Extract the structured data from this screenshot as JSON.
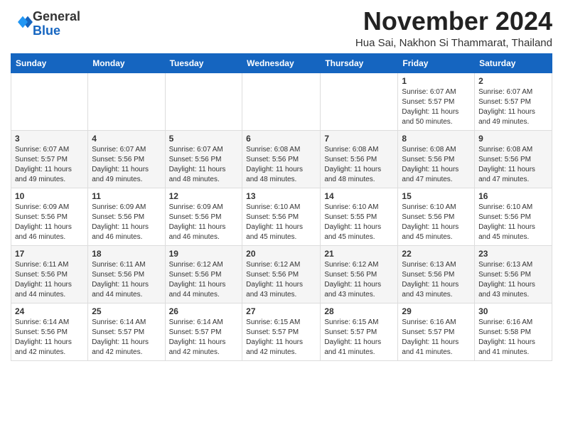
{
  "header": {
    "logo_general": "General",
    "logo_blue": "Blue",
    "month_title": "November 2024",
    "location": "Hua Sai, Nakhon Si Thammarat, Thailand"
  },
  "days_of_week": [
    "Sunday",
    "Monday",
    "Tuesday",
    "Wednesday",
    "Thursday",
    "Friday",
    "Saturday"
  ],
  "weeks": [
    [
      {
        "day": "",
        "info": ""
      },
      {
        "day": "",
        "info": ""
      },
      {
        "day": "",
        "info": ""
      },
      {
        "day": "",
        "info": ""
      },
      {
        "day": "",
        "info": ""
      },
      {
        "day": "1",
        "info": "Sunrise: 6:07 AM\nSunset: 5:57 PM\nDaylight: 11 hours\nand 50 minutes."
      },
      {
        "day": "2",
        "info": "Sunrise: 6:07 AM\nSunset: 5:57 PM\nDaylight: 11 hours\nand 49 minutes."
      }
    ],
    [
      {
        "day": "3",
        "info": "Sunrise: 6:07 AM\nSunset: 5:57 PM\nDaylight: 11 hours\nand 49 minutes."
      },
      {
        "day": "4",
        "info": "Sunrise: 6:07 AM\nSunset: 5:56 PM\nDaylight: 11 hours\nand 49 minutes."
      },
      {
        "day": "5",
        "info": "Sunrise: 6:07 AM\nSunset: 5:56 PM\nDaylight: 11 hours\nand 48 minutes."
      },
      {
        "day": "6",
        "info": "Sunrise: 6:08 AM\nSunset: 5:56 PM\nDaylight: 11 hours\nand 48 minutes."
      },
      {
        "day": "7",
        "info": "Sunrise: 6:08 AM\nSunset: 5:56 PM\nDaylight: 11 hours\nand 48 minutes."
      },
      {
        "day": "8",
        "info": "Sunrise: 6:08 AM\nSunset: 5:56 PM\nDaylight: 11 hours\nand 47 minutes."
      },
      {
        "day": "9",
        "info": "Sunrise: 6:08 AM\nSunset: 5:56 PM\nDaylight: 11 hours\nand 47 minutes."
      }
    ],
    [
      {
        "day": "10",
        "info": "Sunrise: 6:09 AM\nSunset: 5:56 PM\nDaylight: 11 hours\nand 46 minutes."
      },
      {
        "day": "11",
        "info": "Sunrise: 6:09 AM\nSunset: 5:56 PM\nDaylight: 11 hours\nand 46 minutes."
      },
      {
        "day": "12",
        "info": "Sunrise: 6:09 AM\nSunset: 5:56 PM\nDaylight: 11 hours\nand 46 minutes."
      },
      {
        "day": "13",
        "info": "Sunrise: 6:10 AM\nSunset: 5:56 PM\nDaylight: 11 hours\nand 45 minutes."
      },
      {
        "day": "14",
        "info": "Sunrise: 6:10 AM\nSunset: 5:55 PM\nDaylight: 11 hours\nand 45 minutes."
      },
      {
        "day": "15",
        "info": "Sunrise: 6:10 AM\nSunset: 5:56 PM\nDaylight: 11 hours\nand 45 minutes."
      },
      {
        "day": "16",
        "info": "Sunrise: 6:10 AM\nSunset: 5:56 PM\nDaylight: 11 hours\nand 45 minutes."
      }
    ],
    [
      {
        "day": "17",
        "info": "Sunrise: 6:11 AM\nSunset: 5:56 PM\nDaylight: 11 hours\nand 44 minutes."
      },
      {
        "day": "18",
        "info": "Sunrise: 6:11 AM\nSunset: 5:56 PM\nDaylight: 11 hours\nand 44 minutes."
      },
      {
        "day": "19",
        "info": "Sunrise: 6:12 AM\nSunset: 5:56 PM\nDaylight: 11 hours\nand 44 minutes."
      },
      {
        "day": "20",
        "info": "Sunrise: 6:12 AM\nSunset: 5:56 PM\nDaylight: 11 hours\nand 43 minutes."
      },
      {
        "day": "21",
        "info": "Sunrise: 6:12 AM\nSunset: 5:56 PM\nDaylight: 11 hours\nand 43 minutes."
      },
      {
        "day": "22",
        "info": "Sunrise: 6:13 AM\nSunset: 5:56 PM\nDaylight: 11 hours\nand 43 minutes."
      },
      {
        "day": "23",
        "info": "Sunrise: 6:13 AM\nSunset: 5:56 PM\nDaylight: 11 hours\nand 43 minutes."
      }
    ],
    [
      {
        "day": "24",
        "info": "Sunrise: 6:14 AM\nSunset: 5:56 PM\nDaylight: 11 hours\nand 42 minutes."
      },
      {
        "day": "25",
        "info": "Sunrise: 6:14 AM\nSunset: 5:57 PM\nDaylight: 11 hours\nand 42 minutes."
      },
      {
        "day": "26",
        "info": "Sunrise: 6:14 AM\nSunset: 5:57 PM\nDaylight: 11 hours\nand 42 minutes."
      },
      {
        "day": "27",
        "info": "Sunrise: 6:15 AM\nSunset: 5:57 PM\nDaylight: 11 hours\nand 42 minutes."
      },
      {
        "day": "28",
        "info": "Sunrise: 6:15 AM\nSunset: 5:57 PM\nDaylight: 11 hours\nand 41 minutes."
      },
      {
        "day": "29",
        "info": "Sunrise: 6:16 AM\nSunset: 5:57 PM\nDaylight: 11 hours\nand 41 minutes."
      },
      {
        "day": "30",
        "info": "Sunrise: 6:16 AM\nSunset: 5:58 PM\nDaylight: 11 hours\nand 41 minutes."
      }
    ]
  ]
}
